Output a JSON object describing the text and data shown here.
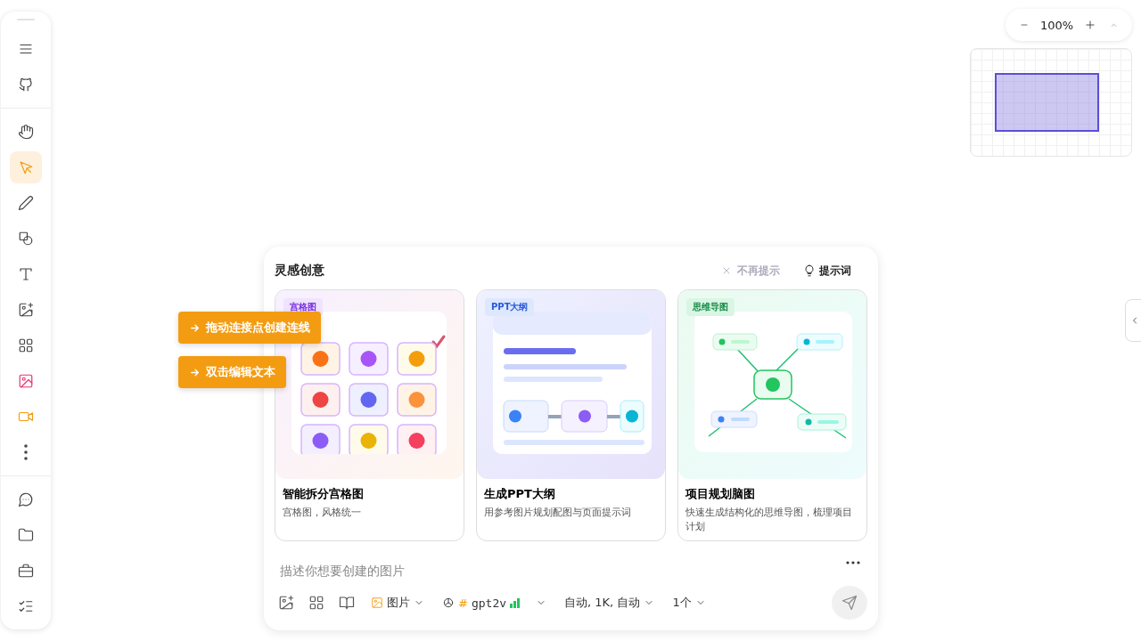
{
  "toolbar": {
    "groups": [
      [
        {
          "kind": "menu",
          "selected": false
        },
        {
          "kind": "github",
          "selected": false
        }
      ],
      [
        {
          "kind": "hand",
          "selected": false
        },
        {
          "kind": "select",
          "selected": true
        },
        {
          "kind": "pencil",
          "selected": false
        },
        {
          "kind": "shapes",
          "selected": false
        },
        {
          "kind": "text",
          "selected": false
        },
        {
          "kind": "image-add",
          "selected": false
        },
        {
          "kind": "grid",
          "selected": false
        },
        {
          "kind": "image",
          "selected": false
        },
        {
          "kind": "video",
          "selected": false
        },
        {
          "kind": "more",
          "selected": false
        }
      ],
      [
        {
          "kind": "chat",
          "selected": false
        },
        {
          "kind": "folder",
          "selected": false
        },
        {
          "kind": "toolbox",
          "selected": false
        },
        {
          "kind": "checklist",
          "selected": false
        }
      ]
    ]
  },
  "zoom": {
    "value": "100%"
  },
  "tooltips": [
    "拖动连接点创建连线",
    "双击编辑文本"
  ],
  "inspiration": {
    "title": "灵感创意",
    "dismiss": "不再提示",
    "prompts": "提示词",
    "cards": [
      {
        "kind": "grid",
        "tag": "宫格图",
        "title": "智能拆分宫格图",
        "description": "宫格图，风格统一"
      },
      {
        "kind": "ppt",
        "tag": "PPT大纲",
        "title": "生成PPT大纲",
        "description": "用参考图片规划配图与页面提示词"
      },
      {
        "kind": "mindmap",
        "tag": "思维导图",
        "title": "项目规划脑图",
        "description": "快速生成结构化的思维导图，梳理项目计划"
      }
    ]
  },
  "composer": {
    "placeholder": "描述你想要创建的图片",
    "mode": "图片",
    "model_prefix": "#",
    "model": "gpt2v",
    "settings": "自动, 1K, 自动",
    "count": "1个"
  }
}
